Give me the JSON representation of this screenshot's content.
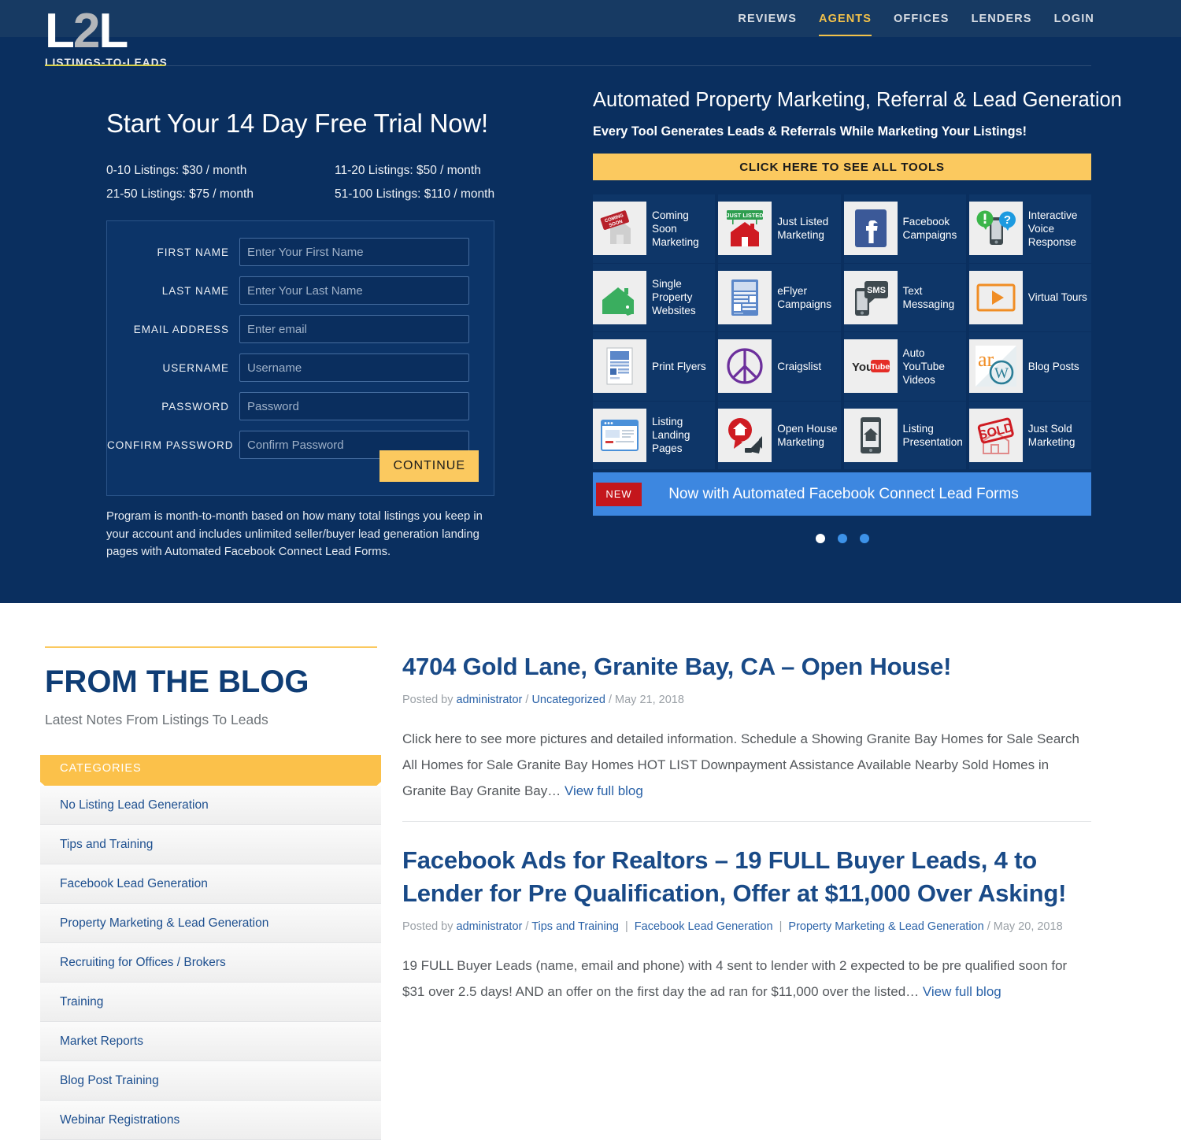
{
  "brand": {
    "logo_main": "L2L",
    "logo_l1": "L",
    "logo_2": "2",
    "logo_l2": "L",
    "logo_sub": "LISTINGS-TO-LEADS",
    "accent_yellow": "#fbc95f",
    "navy": "#0a2f5f",
    "topbar_navy": "#173a63",
    "link_blue": "#2a62a8"
  },
  "nav": {
    "items": [
      {
        "label": "REVIEWS",
        "active": false
      },
      {
        "label": "AGENTS",
        "active": true
      },
      {
        "label": "OFFICES",
        "active": false
      },
      {
        "label": "LENDERS",
        "active": false
      },
      {
        "label": "LOGIN",
        "active": false
      }
    ]
  },
  "hero_left": {
    "title": "Start Your 14 Day Free Trial Now!",
    "pricing": [
      "0-10 Listings: $30 / month",
      "11-20 Listings: $50 / month",
      "21-50 Listings: $75 / month",
      "51-100 Listings: $110 / month"
    ],
    "form": {
      "fields": [
        {
          "label": "FIRST NAME",
          "placeholder": "Enter Your First Name",
          "value": "",
          "type": "text",
          "name": "first-name-field"
        },
        {
          "label": "LAST NAME",
          "placeholder": "Enter Your Last Name",
          "value": "",
          "type": "text",
          "name": "last-name-field"
        },
        {
          "label": "EMAIL ADDRESS",
          "placeholder": "Enter email",
          "value": "",
          "type": "text",
          "name": "email-field"
        },
        {
          "label": "USERNAME",
          "placeholder": "Username",
          "value": "",
          "type": "text",
          "name": "username-field"
        },
        {
          "label": "PASSWORD",
          "placeholder": "Password",
          "value": "",
          "type": "password",
          "name": "password-field"
        },
        {
          "label": "CONFIRM PASSWORD",
          "placeholder": "Confirm Password",
          "value": "",
          "type": "password",
          "name": "confirm-password-field"
        }
      ],
      "submit_label": "CONTINUE"
    },
    "disclaimer": "Program is month-to-month based on how many total listings you keep in your account and includes unlimited seller/buyer lead generation landing pages with Automated Facebook Connect Lead Forms."
  },
  "hero_right": {
    "title": "Automated Property Marketing, Referral & Lead Generation",
    "subtitle": "Every Tool Generates Leads & Referrals While Marketing Your Listings!",
    "cta_label": "CLICK HERE TO SEE ALL TOOLS",
    "tools": [
      {
        "label": "Coming Soon Marketing",
        "icon": "coming-soon-sign-icon"
      },
      {
        "label": "Just Listed Marketing",
        "icon": "just-listed-house-icon"
      },
      {
        "label": "Facebook Campaigns",
        "icon": "facebook-icon"
      },
      {
        "label": "Interactive Voice Response",
        "icon": "phone-chat-bubbles-icon"
      },
      {
        "label": "Single Property Websites",
        "icon": "green-house-tag-icon"
      },
      {
        "label": "eFlyer Campaigns",
        "icon": "document-layout-icon"
      },
      {
        "label": "Text Messaging",
        "icon": "sms-phone-icon"
      },
      {
        "label": "Virtual Tours",
        "icon": "play-button-icon"
      },
      {
        "label": "Print Flyers",
        "icon": "print-flyer-icon"
      },
      {
        "label": "Craigslist",
        "icon": "peace-sign-icon"
      },
      {
        "label": "Auto YouTube Videos",
        "icon": "youtube-icon"
      },
      {
        "label": "Blog Posts",
        "icon": "activerain-wordpress-icon"
      },
      {
        "label": "Listing Landing Pages",
        "icon": "browser-window-icon"
      },
      {
        "label": "Open House Marketing",
        "icon": "megaphone-house-icon"
      },
      {
        "label": "Listing Presentation",
        "icon": "tablet-house-icon"
      },
      {
        "label": "Just Sold Marketing",
        "icon": "sold-stamp-icon"
      }
    ],
    "banner": {
      "badge": "NEW",
      "text": "Now with Automated Facebook Connect Lead Forms"
    },
    "carousel": {
      "slides": 3,
      "active_index": 0
    }
  },
  "blog": {
    "heading": "FROM THE BLOG",
    "subheading": "Latest Notes From Listings To Leads",
    "categories_title": "CATEGORIES",
    "categories": [
      "No Listing Lead Generation",
      "Tips and Training",
      "Facebook Lead Generation",
      "Property Marketing & Lead Generation",
      "Recruiting for Offices / Brokers",
      "Training",
      "Market Reports",
      "Blog Post Training",
      "Webinar Registrations"
    ],
    "posts": [
      {
        "title": "4704 Gold Lane, Granite Bay, CA – Open House!",
        "meta_prefix": "Posted by",
        "author": "administrator",
        "sep1": "/",
        "categories": [
          "Uncategorized"
        ],
        "sep2": "/",
        "date": "May 21, 2018",
        "excerpt": "Click here to see more pictures and detailed information.    Schedule a Showing Granite Bay Homes for Sale Search All Homes for Sale Granite Bay Homes HOT LIST Downpayment Assistance Available Nearby Sold Homes in Granite Bay Granite Bay… ",
        "read_more": "View full blog"
      },
      {
        "title": "Facebook Ads for Realtors – 19 FULL Buyer Leads, 4 to Lender for Pre Qualification, Offer at $11,000 Over Asking!",
        "meta_prefix": "Posted by",
        "author": "administrator",
        "sep1": "/",
        "categories": [
          "Tips and Training",
          "Facebook Lead Generation",
          "Property Marketing & Lead Generation"
        ],
        "sep2": "/",
        "date": "May 20, 2018",
        "excerpt": "19 FULL Buyer Leads (name, email and phone) with 4 sent to lender with 2 expected to be pre qualified soon for $31 over 2.5 days! AND an offer on the first day the ad ran for $11,000 over the listed… ",
        "read_more": "View full blog"
      }
    ]
  }
}
